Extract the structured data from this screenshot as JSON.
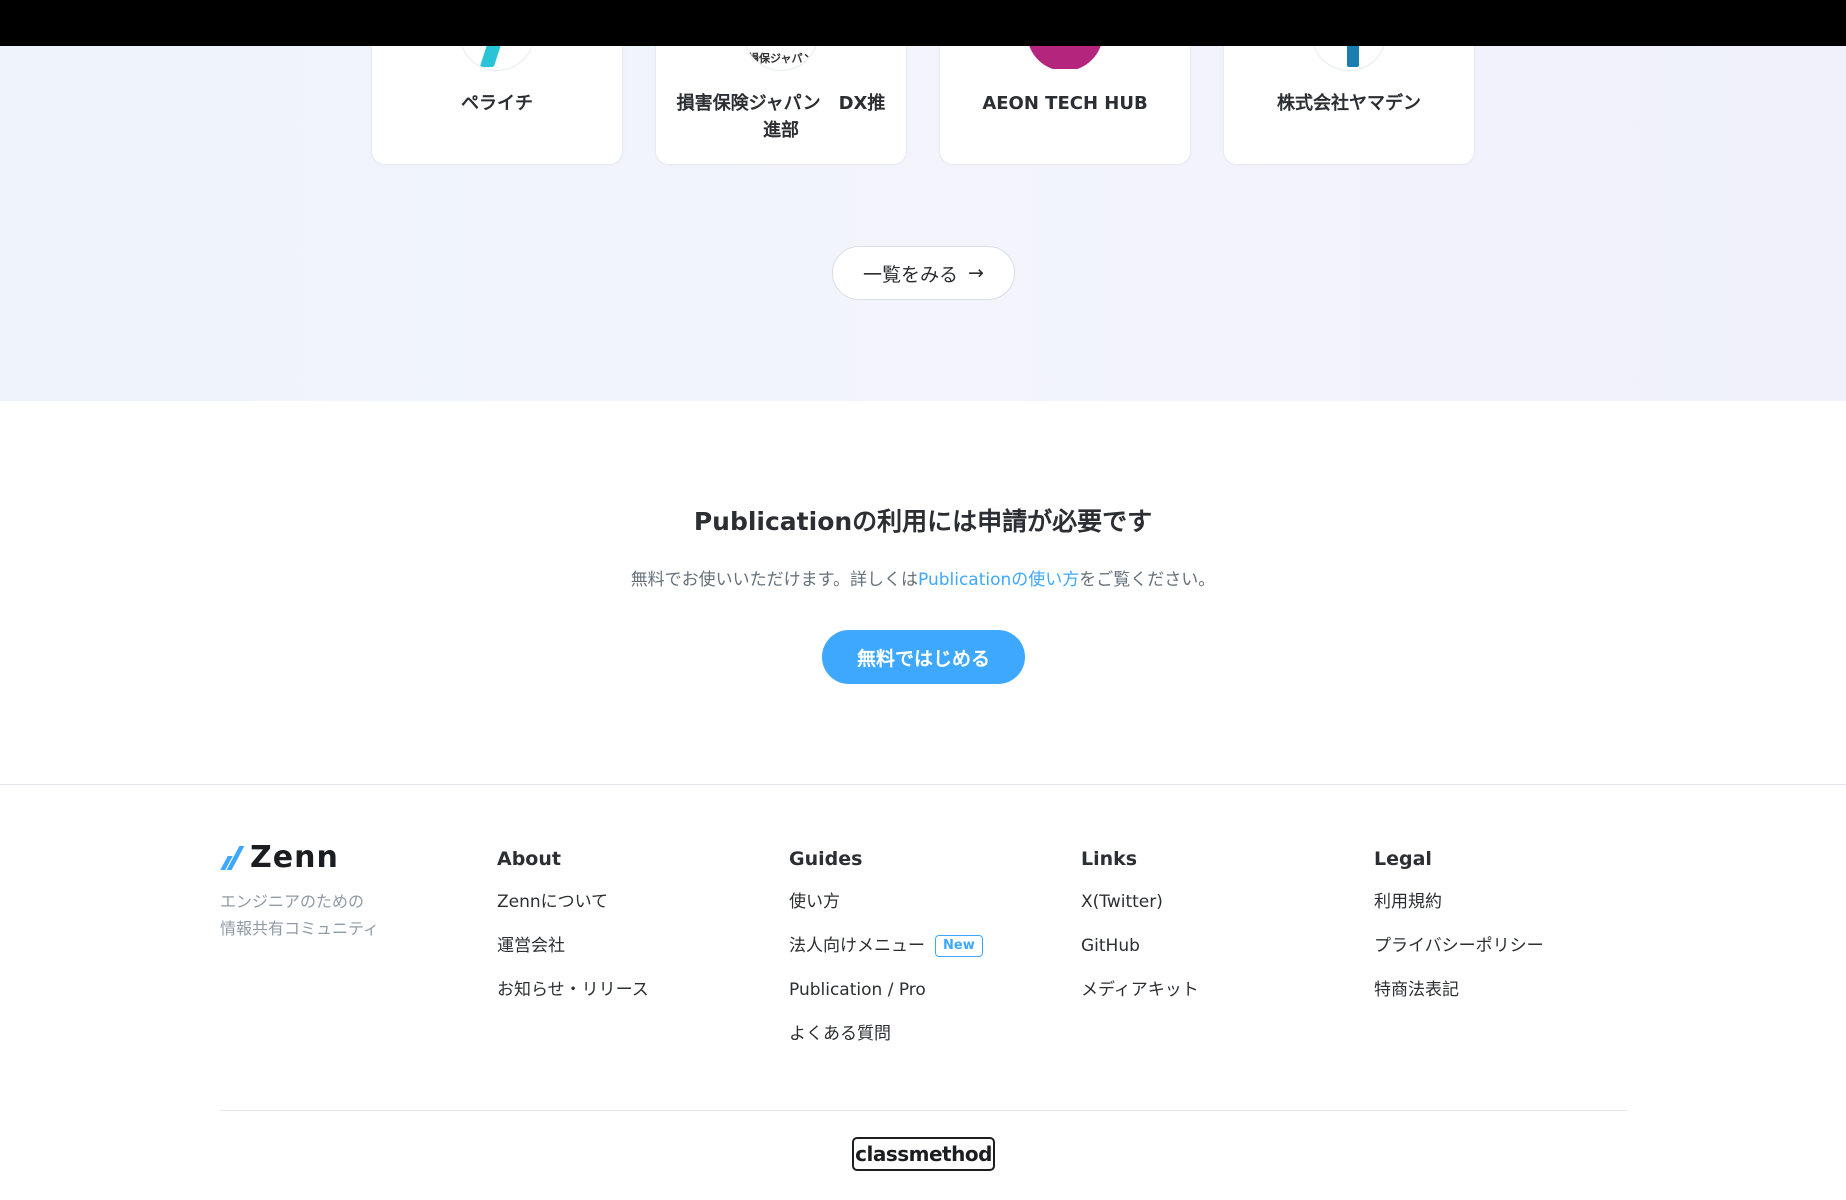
{
  "publications": {
    "cards": [
      {
        "name": "ペライチ"
      },
      {
        "name": "損害保険ジャパン　DX推進部",
        "logo_text": "損保ジャパン"
      },
      {
        "name": "AEON TECH HUB"
      },
      {
        "name": "株式会社ヤマデン"
      }
    ],
    "view_all_label": "一覧をみる",
    "view_all_arrow": "→"
  },
  "cta": {
    "title": "Publicationの利用には申請が必要です",
    "desc_before": "無料でお使いいただけます。詳しくは",
    "desc_link": "Publicationの使い方",
    "desc_after": "をご覧ください。",
    "button": "無料ではじめる"
  },
  "footer": {
    "brand": "Zenn",
    "tagline": "エンジニアのための\n情報共有コミュニティ",
    "columns": [
      {
        "heading": "About",
        "links": [
          {
            "label": "Zennについて"
          },
          {
            "label": "運営会社"
          },
          {
            "label": "お知らせ・リリース"
          }
        ]
      },
      {
        "heading": "Guides",
        "links": [
          {
            "label": "使い方"
          },
          {
            "label": "法人向けメニュー",
            "badge": "New"
          },
          {
            "label": "Publication / Pro"
          },
          {
            "label": "よくある質問"
          }
        ]
      },
      {
        "heading": "Links",
        "links": [
          {
            "label": "X(Twitter)"
          },
          {
            "label": "GitHub"
          },
          {
            "label": "メディアキット"
          }
        ]
      },
      {
        "heading": "Legal",
        "links": [
          {
            "label": "利用規約"
          },
          {
            "label": "プライバシーポリシー"
          },
          {
            "label": "特商法表記"
          }
        ]
      }
    ],
    "company_logo": "classmethod"
  },
  "colors": {
    "accent": "#3ea8ff",
    "text": "#2b2f33",
    "muted": "#65717b"
  }
}
